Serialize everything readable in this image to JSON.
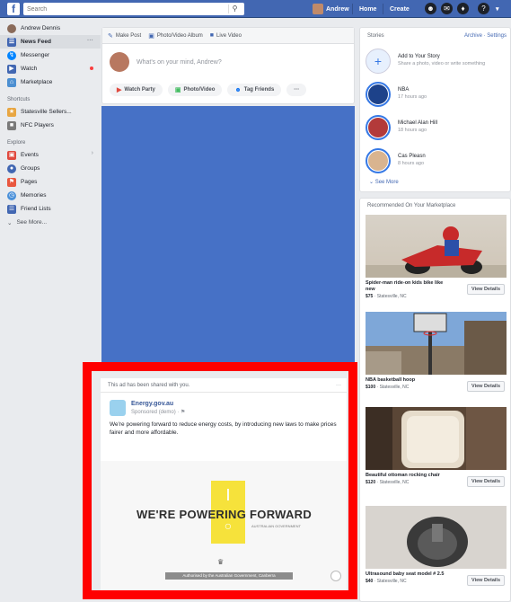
{
  "topbar": {
    "search_placeholder": "Search",
    "user_name": "Andrew",
    "home_label": "Home",
    "create_label": "Create"
  },
  "sidebar": {
    "profile_name": "Andrew Dennis",
    "items": [
      {
        "label": "News Feed",
        "icon": "news-feed-icon",
        "color": "#4267b2"
      },
      {
        "label": "Messenger",
        "icon": "messenger-icon",
        "color": "#0084ff"
      },
      {
        "label": "Watch",
        "icon": "watch-icon",
        "color": "#4267b2"
      },
      {
        "label": "Marketplace",
        "icon": "marketplace-icon",
        "color": "#4c8fd1"
      }
    ],
    "shortcuts_header": "Shortcuts",
    "shortcuts": [
      {
        "label": "Statesville Sellers...",
        "icon": "group-icon",
        "color": "#e8a642"
      },
      {
        "label": "NFC Players",
        "icon": "group-icon",
        "color": "#7a7a7a"
      }
    ],
    "explore_header": "Explore",
    "explore": [
      {
        "label": "Events",
        "icon": "events-icon",
        "color": "#e04a3f"
      },
      {
        "label": "Groups",
        "icon": "groups-icon",
        "color": "#4267b2"
      },
      {
        "label": "Pages",
        "icon": "pages-icon",
        "color": "#e9573f"
      },
      {
        "label": "Memories",
        "icon": "memories-icon",
        "color": "#4a90d9"
      },
      {
        "label": "Friend Lists",
        "icon": "friend-lists-icon",
        "color": "#4267b2"
      }
    ],
    "see_more": "See More..."
  },
  "composer": {
    "tabs": [
      "Make Post",
      "Photo/Video Album",
      "Live Video"
    ],
    "placeholder": "What's on your mind, Andrew?",
    "actions": [
      "Watch Party",
      "Photo/Video",
      "Tag Friends",
      "···"
    ]
  },
  "post": {
    "shared_notice": "This ad has been shared with you.",
    "page_name": "Energy.gov.au",
    "sponsored": "Sponsored (demo) · ⚑",
    "text": "We're powering forward to reduce energy costs, by introducing new laws to make prices fairer and more affordable.",
    "headline": "WE'RE POWERING FORWARD",
    "subline": "AUSTRALIAN GOVERNMENT",
    "caption": "Authorised by the Australian Government, Canberra"
  },
  "stories": {
    "header": "Stories",
    "links": "Archive · Settings",
    "items": [
      {
        "title": "Add to Your Story",
        "sub": "Share a photo, video or write something",
        "kind": "add"
      },
      {
        "title": "NBA",
        "sub": "17 hours ago",
        "color": "#1d428a"
      },
      {
        "title": "Michael Alan Hill",
        "sub": "18 hours ago",
        "color": "#b33a3a"
      },
      {
        "title": "Cas Pleasn",
        "sub": "8 hours ago",
        "color": "#d9b48f"
      }
    ],
    "see_more": "See More"
  },
  "marketplace": {
    "header": "Recommended On Your Marketplace",
    "button_label": "View Details",
    "items": [
      {
        "title": "Spider-man ride-on kids bike like new",
        "price": "$75",
        "location": "Statesville, NC"
      },
      {
        "title": "NBA basketball hoop",
        "price": "$100",
        "location": "Statesville, NC"
      },
      {
        "title": "Beautiful ottoman rocking chair",
        "price": "$120",
        "location": "Statesville, NC"
      },
      {
        "title": "Ultrasound baby seat model # 2.5",
        "price": "$40",
        "location": "Statesville, NC"
      }
    ]
  }
}
